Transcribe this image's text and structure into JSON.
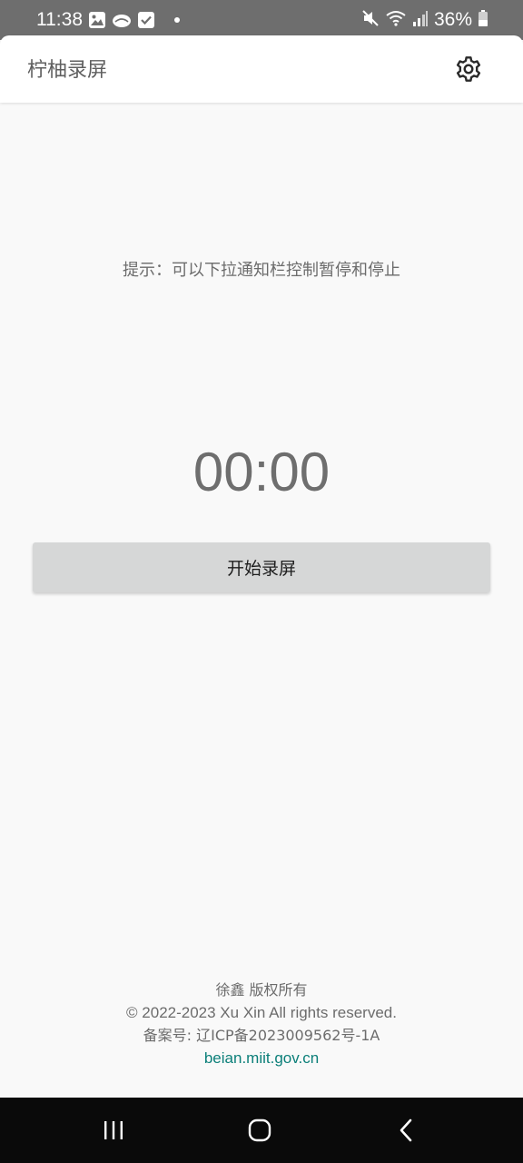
{
  "status_bar": {
    "time": "11:38",
    "battery": "36%",
    "icons_left": [
      "gallery-icon",
      "cloud-icon",
      "check-icon",
      "dot-icon"
    ],
    "icons_right": [
      "mute-icon",
      "wifi-icon",
      "signal-icon",
      "battery-icon"
    ]
  },
  "app_bar": {
    "title": "柠柚录屏",
    "settings_icon": "gear-icon"
  },
  "main": {
    "hint": "提示：可以下拉通知栏控制暂停和停止",
    "timer": "00:00",
    "start_button": "开始录屏"
  },
  "footer": {
    "owner": "徐鑫 版权所有",
    "copyright": "© 2022-2023 Xu Xin All rights reserved.",
    "icp": "备案号: 辽ICP备2023009562号-1A",
    "link": "beian.miit.gov.cn"
  },
  "colors": {
    "status_bar_bg": "#6e6e6e",
    "background": "#f9f9f9",
    "button_bg": "#d6d7d7",
    "link": "#0b7f79",
    "nav_bar_bg": "#0a0a0a"
  }
}
